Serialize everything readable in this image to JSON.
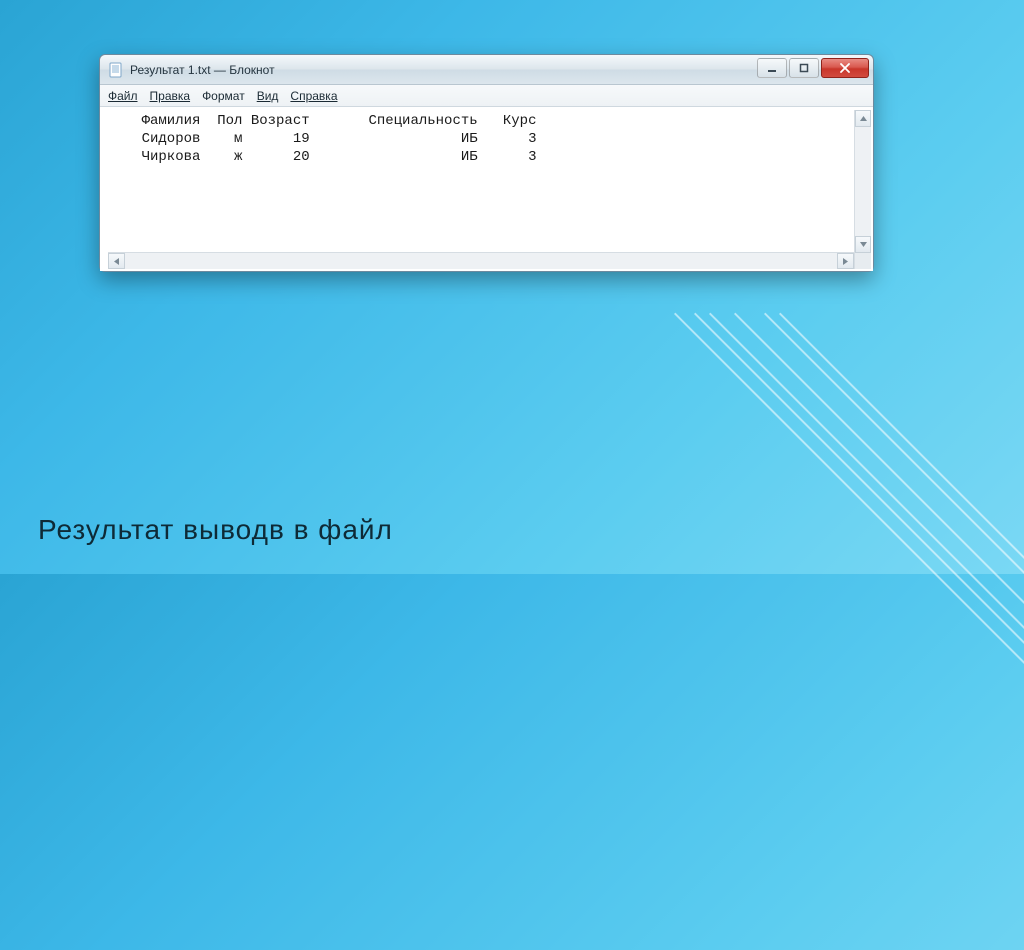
{
  "slide": {
    "caption": "Результат выводв в файл"
  },
  "window": {
    "title": "Результат 1.txt — Блокнот",
    "menu": {
      "file": "Файл",
      "edit": "Правка",
      "format": "Формат",
      "view": "Вид",
      "help": "Справка"
    },
    "controls": {
      "minimize": "minimize",
      "maximize": "maximize",
      "close": "close"
    }
  },
  "file_content": {
    "header": {
      "col1": "Фамилия",
      "col2": "Пол",
      "col3": "Возраст",
      "col4": "Специальность",
      "col5": "Курс"
    },
    "rows": [
      {
        "name": "Сидоров",
        "sex": "м",
        "age": "19",
        "spec": "ИБ",
        "course": "3"
      },
      {
        "name": "Чиркова",
        "sex": "ж",
        "age": "20",
        "spec": "ИБ",
        "course": "3"
      }
    ],
    "rendered_text": "    Фамилия  Пол Возраст       Специальность   Курс\n    Сидоров    м      19                  ИБ      3\n    Чиркова    ж      20                  ИБ      3"
  }
}
